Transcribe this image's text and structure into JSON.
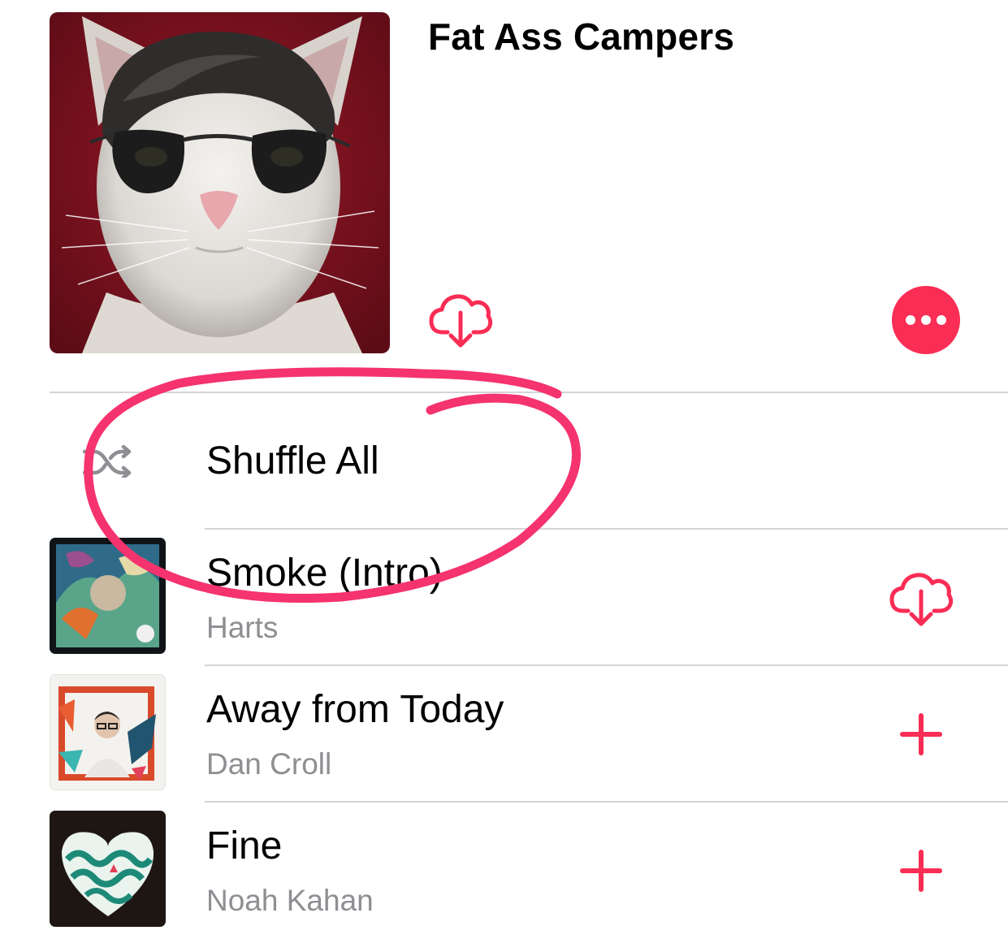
{
  "playlist": {
    "title": "Fat Ass Campers"
  },
  "shuffle": {
    "label": "Shuffle All"
  },
  "songs": [
    {
      "title": "Smoke (Intro)",
      "artist": "Harts",
      "action": "download"
    },
    {
      "title": "Away from Today",
      "artist": "Dan Croll",
      "action": "add"
    },
    {
      "title": "Fine",
      "artist": "Noah Kahan",
      "action": "add"
    }
  ],
  "colors": {
    "accent": "#fa2d55",
    "secondary_text": "#8e8e93",
    "divider": "#d4d4d8",
    "annotation": "#f5336e"
  },
  "icons": {
    "header_download": "cloud-download-icon",
    "more": "more-icon",
    "shuffle": "shuffle-icon",
    "song_download": "cloud-download-icon",
    "add": "plus-icon"
  }
}
